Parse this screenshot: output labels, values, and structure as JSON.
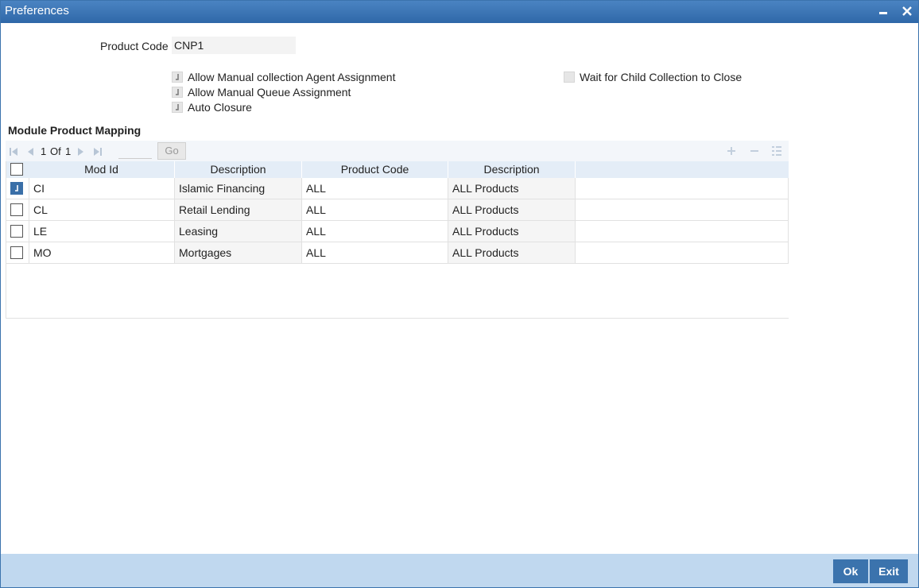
{
  "window": {
    "title": "Preferences"
  },
  "form": {
    "product_code_label": "Product Code",
    "product_code_value": "CNP1",
    "options": [
      {
        "label": "Allow Manual collection Agent Assignment",
        "checked": true
      },
      {
        "label": "Allow Manual Queue Assignment",
        "checked": true
      },
      {
        "label": "Auto Closure",
        "checked": true
      },
      {
        "label": "Wait for Child Collection to Close",
        "checked": false
      }
    ]
  },
  "mapping": {
    "title": "Module Product Mapping",
    "pager": {
      "current": "1",
      "of_label": "Of",
      "total": "1",
      "go_label": "Go"
    },
    "columns": [
      "Mod Id",
      "Description",
      "Product Code",
      "Description"
    ],
    "rows": [
      {
        "checked": true,
        "mod_id": "CI",
        "description": "Islamic Financing",
        "product_code": "ALL",
        "product_description": "ALL Products"
      },
      {
        "checked": false,
        "mod_id": "CL",
        "description": "Retail Lending",
        "product_code": "ALL",
        "product_description": "ALL Products"
      },
      {
        "checked": false,
        "mod_id": "LE",
        "description": "Leasing",
        "product_code": "ALL",
        "product_description": "ALL Products"
      },
      {
        "checked": false,
        "mod_id": "MO",
        "description": "Mortgages",
        "product_code": "ALL",
        "product_description": "ALL Products"
      }
    ]
  },
  "footer": {
    "ok_label": "Ok",
    "exit_label": "Exit"
  },
  "colors": {
    "accent": "#3b73ad",
    "footer_bg": "#c0d8ef",
    "grid_header": "#e4edf7"
  }
}
